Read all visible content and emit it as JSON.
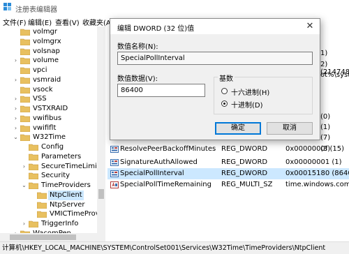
{
  "app": {
    "title": "注册表编辑器"
  },
  "menu": [
    "文件(F)",
    "编辑(E)",
    "查看(V)",
    "收藏夹(A)"
  ],
  "tree": [
    {
      "label": "volmgr",
      "expander": "",
      "selected": false
    },
    {
      "label": "volmgrx",
      "expander": "",
      "selected": false
    },
    {
      "label": "volsnap",
      "expander": "",
      "selected": false
    },
    {
      "label": "volume",
      "expander": "›",
      "selected": false
    },
    {
      "label": "vpci",
      "expander": "",
      "selected": false
    },
    {
      "label": "vsmraid",
      "expander": "›",
      "selected": false
    },
    {
      "label": "vsock",
      "expander": "",
      "selected": false
    },
    {
      "label": "VSS",
      "expander": "›",
      "selected": false
    },
    {
      "label": "VSTXRAID",
      "expander": "›",
      "selected": false
    },
    {
      "label": "vwifibus",
      "expander": "›",
      "selected": false
    },
    {
      "label": "vwififlt",
      "expander": "›",
      "selected": false
    },
    {
      "label": "W32Time",
      "expander": "⌄",
      "selected": false
    },
    {
      "label": "Config",
      "expander": "",
      "selected": false
    },
    {
      "label": "Parameters",
      "expander": "",
      "selected": false
    },
    {
      "label": "SecureTimeLimits",
      "expander": "›",
      "selected": false
    },
    {
      "label": "Security",
      "expander": "",
      "selected": false
    },
    {
      "label": "TimeProviders",
      "expander": "⌄",
      "selected": false
    },
    {
      "label": "NtpClient",
      "expander": "",
      "selected": true
    },
    {
      "label": "NtpServer",
      "expander": "",
      "selected": false
    },
    {
      "label": "VMICTimeProvide",
      "expander": "",
      "selected": false
    },
    {
      "label": "TriggerInfo",
      "expander": "›",
      "selected": false
    },
    {
      "label": "WacomPen",
      "expander": "›",
      "selected": false
    }
  ],
  "values_partial": [
    "1)",
    "2) (214748",
    "ot%\\syste",
    "(0)",
    "(1)",
    "(7)",
    "(3)"
  ],
  "values": [
    {
      "name": "ResolvePeerBackoffMinutes",
      "type": "REG_DWORD",
      "data": "0x0000000f (15)",
      "kind": "dword",
      "selected": false
    },
    {
      "name": "SignatureAuthAllowed",
      "type": "REG_DWORD",
      "data": "0x00000001 (1)",
      "kind": "dword",
      "selected": false
    },
    {
      "name": "SpecialPollInterval",
      "type": "REG_DWORD",
      "data": "0x00015180 (86400)",
      "kind": "dword",
      "selected": true
    },
    {
      "name": "SpecialPollTimeRemaining",
      "type": "REG_MULTI_SZ",
      "data": "time.windows.com,7",
      "kind": "string",
      "selected": false
    }
  ],
  "status": {
    "path": "计算机\\HKEY_LOCAL_MACHINE\\SYSTEM\\ControlSet001\\Services\\W32Time\\TimeProviders\\NtpClient"
  },
  "dialog": {
    "title": "编辑 DWORD (32 位)值",
    "value_name_label": "数值名称(N):",
    "value_name": "SpecialPollInterval",
    "value_data_label": "数值数据(V):",
    "value_data": "86400",
    "base_label": "基数",
    "hex_label": "十六进制(H)",
    "dec_label": "十进制(D)",
    "base_selected": "decimal",
    "ok_label": "确定",
    "cancel_label": "取消"
  },
  "colors": {
    "selection": "#cce8ff",
    "folder": "#e8c060",
    "accent": "#0078d7"
  }
}
